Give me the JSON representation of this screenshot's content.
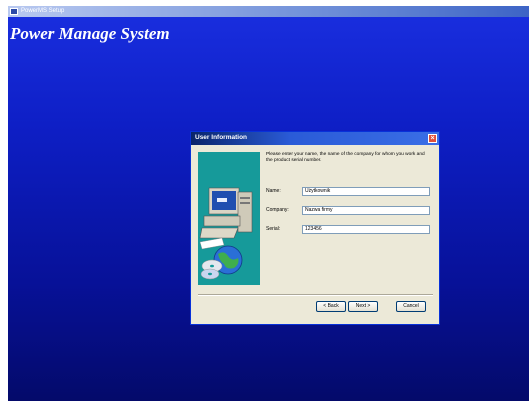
{
  "window": {
    "title": "PowerMS Setup"
  },
  "app": {
    "title": "Power Manage System"
  },
  "dialog": {
    "title": "User Information",
    "close_glyph": "×",
    "description": "Please enter your name, the name of the company for whom you work and the product serial number.",
    "fields": [
      {
        "label": "Name:",
        "value": "Użytkownik"
      },
      {
        "label": "Company:",
        "value": "Nazwa firmy"
      },
      {
        "label": "Serial:",
        "value": "123456"
      }
    ],
    "buttons": {
      "back": "< Back",
      "next": "Next >",
      "cancel": "Cancel"
    },
    "art_icon": "computer-with-globe-and-cds-icon"
  },
  "colors": {
    "desktop": "#0e1fc6",
    "dialog_bg": "#ece9d8",
    "art_bg": "#169a9a",
    "titlebar": "#2a5bd7"
  }
}
